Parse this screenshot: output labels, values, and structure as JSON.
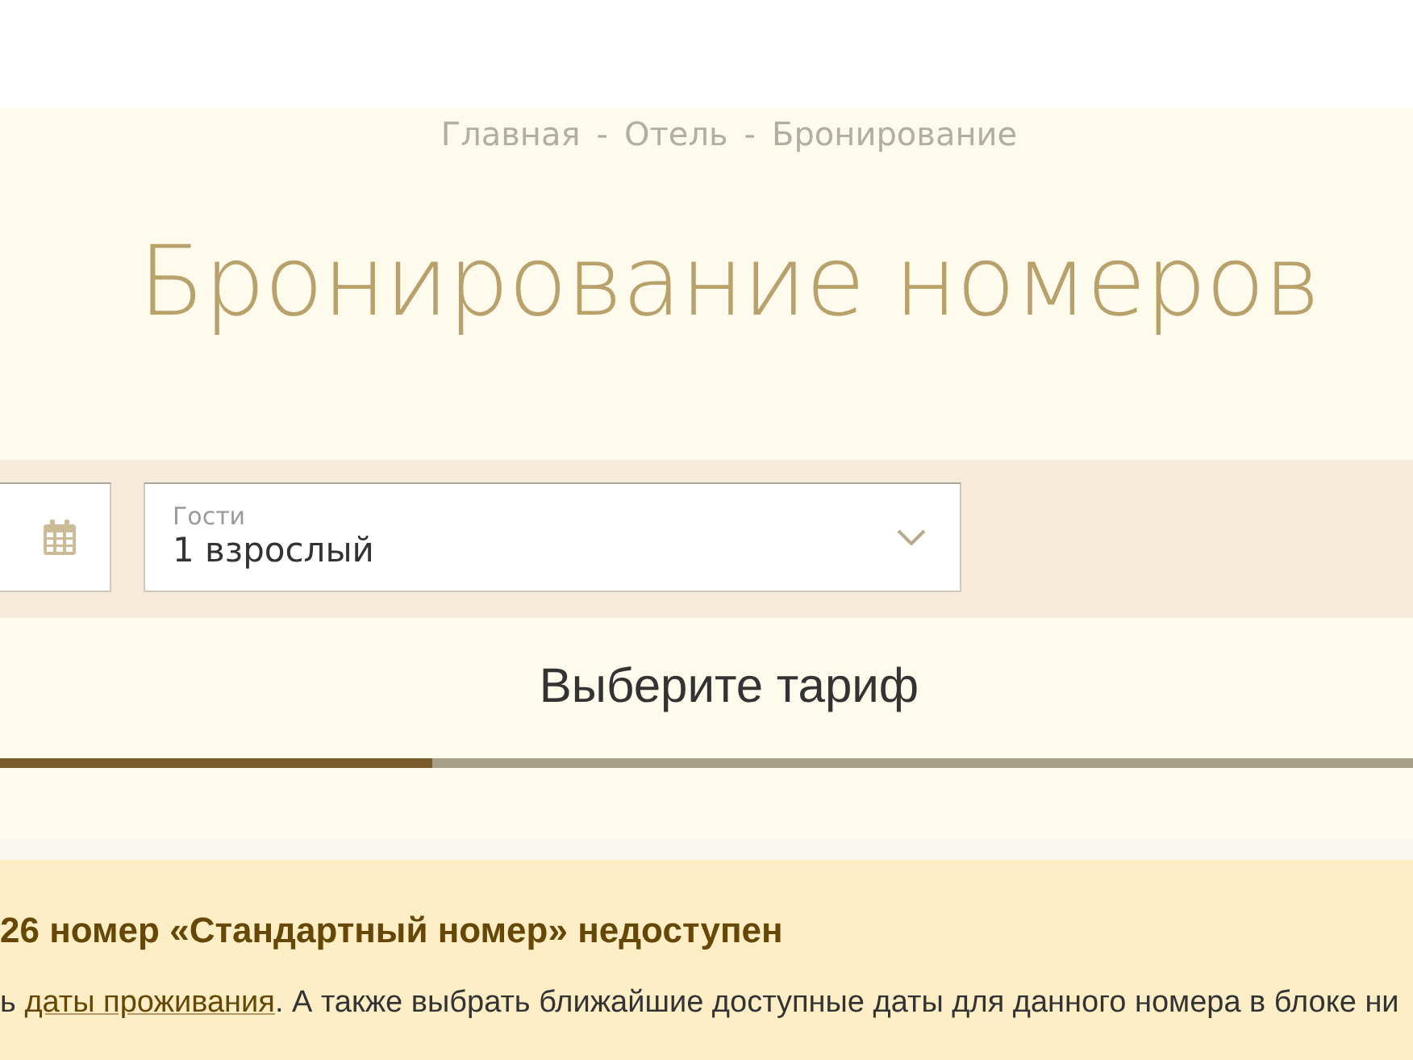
{
  "breadcrumb": [
    {
      "kind": "link",
      "text": "Главная"
    },
    {
      "kind": "separator",
      "text": "-"
    },
    {
      "kind": "link",
      "text": "Отель"
    },
    {
      "kind": "separator",
      "text": "-"
    },
    {
      "kind": "current",
      "text": "Бронирование"
    }
  ],
  "title": "Бронирование номеров",
  "search_bar": {
    "guests": {
      "label": "Гости",
      "value": "1 взрослый"
    }
  },
  "step": {
    "title": "Выберите тариф",
    "progress": {
      "level": 0.306
    }
  },
  "notice": {
    "heading": "26 номер «Стандартный номер» недоступен",
    "text_before": "ь ",
    "link": "даты проживания",
    "text_after": ". А также выбрать ближайшие доступные даты для данного номера в блоке ни"
  }
}
